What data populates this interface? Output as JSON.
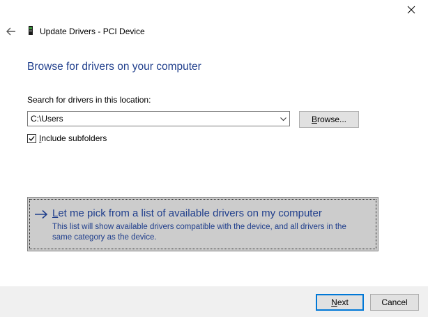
{
  "window": {
    "title": "Update Drivers - PCI Device",
    "back_icon": "back-arrow-icon",
    "device_icon": "pci-device-icon",
    "close_icon": "close-icon"
  },
  "page": {
    "heading": "Browse for drivers on your computer"
  },
  "search": {
    "label": "Search for drivers in this location:",
    "path_value": "C:\\Users",
    "dropdown_icon": "chevron-down-icon",
    "browse_label_underlined": "B",
    "browse_label_rest": "rowse..."
  },
  "subfolders": {
    "checked": true,
    "label_underlined": "I",
    "label_rest": "nclude subfolders"
  },
  "pick_option": {
    "icon": "right-arrow-icon",
    "title_underlined": "L",
    "title_rest": "et me pick from a list of available drivers on my computer",
    "description": "This list will show available drivers compatible with the device, and all drivers in the same category as the device."
  },
  "footer": {
    "next_underlined": "N",
    "next_rest": "ext",
    "cancel_label": "Cancel"
  },
  "colors": {
    "heading_blue": "#1f3e8c",
    "focus_border": "#0078d7",
    "option_bg": "#cccccc",
    "footer_bg": "#f0f0f0"
  }
}
